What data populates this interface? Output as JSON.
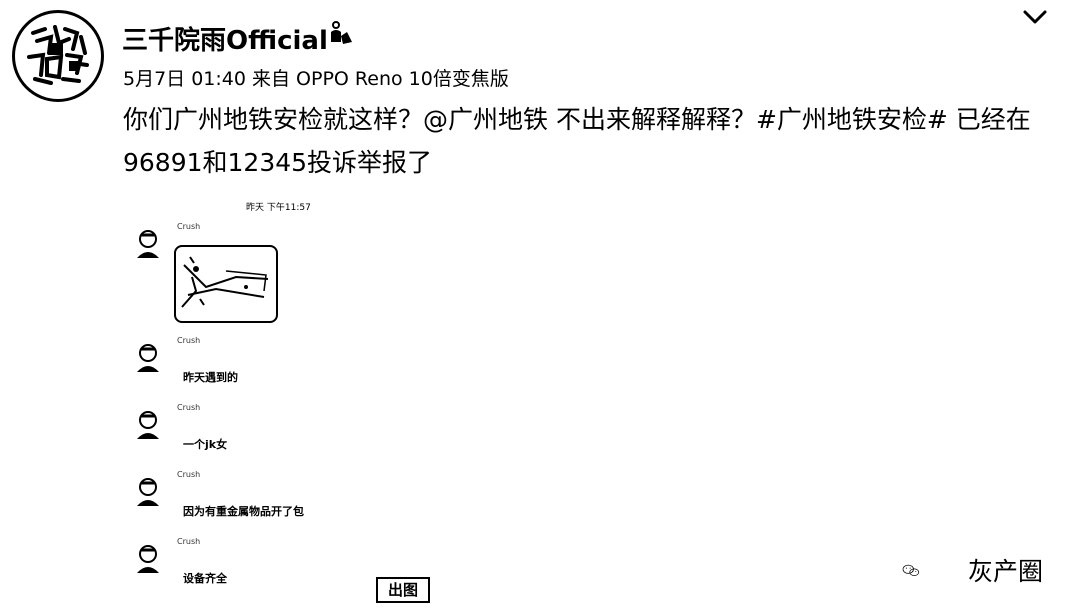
{
  "post": {
    "author": "三千院雨Official",
    "meta": "5月7日 01:40 来自 OPPO Reno 10倍变焦版",
    "text": "你们广州地铁安检就这样？@广州地铁 不出来解释解释？#广州地铁安检# 已经在96891和12345投诉举报了"
  },
  "chat": {
    "date": "昨天 下午11:57",
    "sender": "Crush",
    "messages": [
      "昨天遇到的",
      "一个jk女",
      "因为有重金属物品开了包",
      "设备齐全"
    ]
  },
  "stamp_text": "出图",
  "watermark": "灰产圈",
  "icons": [
    "avatar-seal",
    "verified-user-icon",
    "chevron-down-icon",
    "wechat-icon"
  ]
}
